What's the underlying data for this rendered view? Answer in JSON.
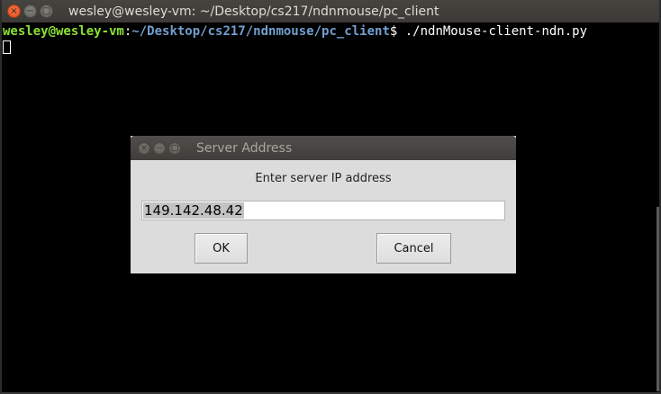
{
  "terminal": {
    "title": "wesley@wesley-vm: ~/Desktop/cs217/ndnmouse/pc_client",
    "prompt_user": "wesley@wesley-vm",
    "prompt_sep": ":",
    "prompt_path": "~/Desktop/cs217/ndnmouse/pc_client",
    "prompt_dollar": "$ ",
    "command": "./ndnMouse-client-ndn.py",
    "window_buttons": {
      "close_icon": "×",
      "minimize_icon": "−",
      "maximize_icon": "□"
    }
  },
  "dialog": {
    "title": "Server Address",
    "prompt": "Enter server IP address",
    "input_value": "149.142.48.42",
    "ok_label": "OK",
    "cancel_label": "Cancel",
    "window_buttons": {
      "close_icon": "×",
      "minimize_icon": "−",
      "maximize_icon": "□"
    }
  },
  "colors": {
    "prompt_user": "#8ae234",
    "prompt_path": "#729fcf",
    "terminal_bg": "#000000",
    "dialog_bg": "#dcdcdc",
    "close_button": "#df4a16"
  }
}
